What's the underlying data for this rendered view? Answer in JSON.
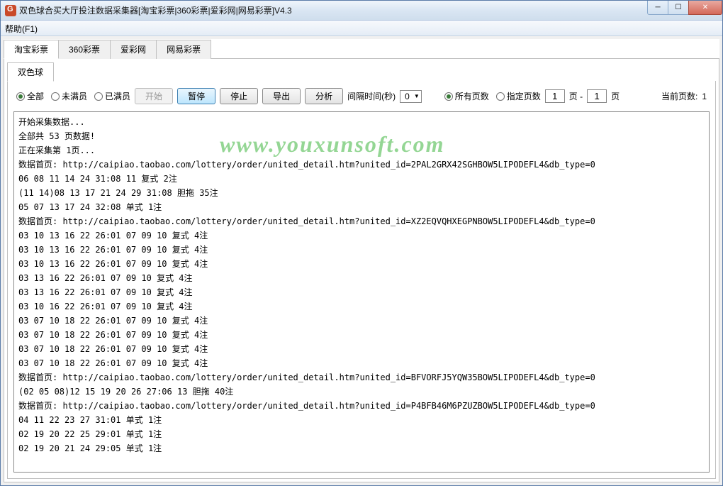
{
  "window": {
    "title": "双色球合买大厅投注数据采集器[淘宝彩票|360彩票|爱彩网|网易彩票]V4.3"
  },
  "menu": {
    "help": "帮助(F1)"
  },
  "outerTabs": [
    {
      "label": "淘宝彩票"
    },
    {
      "label": "360彩票"
    },
    {
      "label": "爱彩网"
    },
    {
      "label": "网易彩票"
    }
  ],
  "innerTabs": [
    {
      "label": "双色球"
    }
  ],
  "toolbar": {
    "radios1": {
      "all": "全部",
      "notFull": "未满员",
      "full": "已满员"
    },
    "buttons": {
      "start": "开始",
      "pause": "暂停",
      "stop": "停止",
      "export": "导出",
      "analyze": "分析"
    },
    "intervalLabel": "间隔时间(秒)",
    "intervalValue": "0",
    "radios2": {
      "allPages": "所有页数",
      "specifyPages": "指定页数"
    },
    "pageFrom": "1",
    "pageSep": "页 -",
    "pageTo": "1",
    "pageUnit": "页",
    "currentPageLabel": "当前页数:",
    "currentPageValue": "1"
  },
  "watermark": "www.youxunsoft.com",
  "log": [
    "开始采集数据...",
    "全部共 53 页数据!",
    "正在采集第 1页...",
    "数据首页: http://caipiao.taobao.com/lottery/order/united_detail.htm?united_id=2PAL2GRX42SGHBOW5LIPODEFL4&db_type=0",
    "06 08 11 14 24 31:08 11 复式 2注",
    "(11 14)08 13 17 21 24 29 31:08 胆拖 35注",
    "05 07 13 17 24 32:08 单式 1注",
    "数据首页: http://caipiao.taobao.com/lottery/order/united_detail.htm?united_id=XZ2EQVQHXEGPNBOW5LIPODEFL4&db_type=0",
    "03 10 13 16 22 26:01 07 09 10 复式 4注",
    "03 10 13 16 22 26:01 07 09 10 复式 4注",
    "03 10 13 16 22 26:01 07 09 10 复式 4注",
    "03 13 16 22 26:01 07 09 10 复式 4注",
    "03 13 16 22 26:01 07 09 10 复式 4注",
    "03 10 16 22 26:01 07 09 10 复式 4注",
    "03 07 10 18 22 26:01 07 09 10 复式 4注",
    "03 07 10 18 22 26:01 07 09 10 复式 4注",
    "03 07 10 18 22 26:01 07 09 10 复式 4注",
    "03 07 10 18 22 26:01 07 09 10 复式 4注",
    "数据首页: http://caipiao.taobao.com/lottery/order/united_detail.htm?united_id=BFVORFJ5YQW35BOW5LIPODEFL4&db_type=0",
    "(02 05 08)12 15 19 20 26 27:06 13 胆拖 40注",
    "数据首页: http://caipiao.taobao.com/lottery/order/united_detail.htm?united_id=P4BFB46M6PZUZBOW5LIPODEFL4&db_type=0",
    "04 11 22 23 27 31:01 单式 1注",
    "02 19 20 22 25 29:01 单式 1注",
    "02 19 20 21 24 29:05 单式 1注"
  ]
}
